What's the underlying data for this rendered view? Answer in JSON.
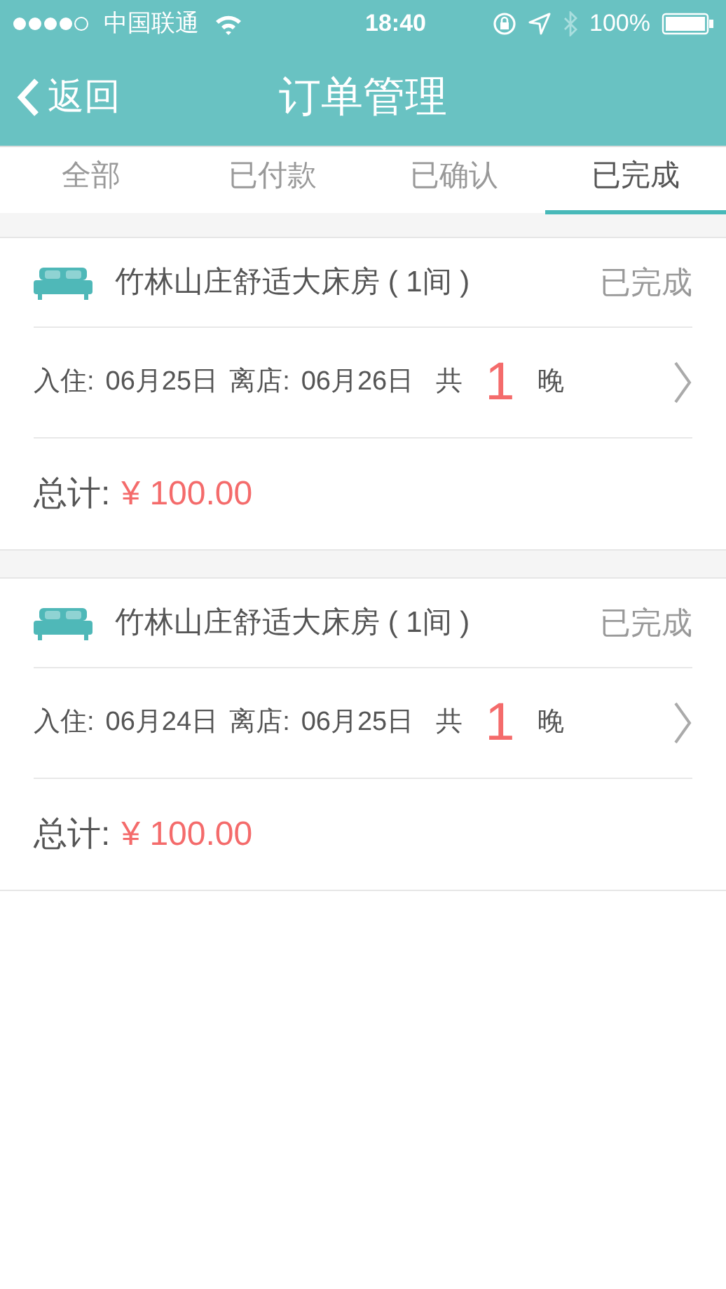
{
  "status_bar": {
    "carrier": "中国联通",
    "time": "18:40",
    "battery": "100%"
  },
  "nav": {
    "back": "返回",
    "title": "订单管理"
  },
  "tabs": [
    {
      "label": "全部",
      "selected": false
    },
    {
      "label": "已付款",
      "selected": false
    },
    {
      "label": "已确认",
      "selected": false
    },
    {
      "label": "已完成",
      "selected": true
    }
  ],
  "orders": [
    {
      "title": "竹林山庄舒适大床房 ( 1间 )",
      "status": "已完成",
      "checkin_label": "入住:",
      "checkin": "06月25日",
      "checkout_label": "离店:",
      "checkout": "06月26日",
      "nights_prefix": "共",
      "nights": "1",
      "nights_suffix": "晚",
      "total_label": "总计:",
      "total": "¥ 100.00"
    },
    {
      "title": "竹林山庄舒适大床房 ( 1间 )",
      "status": "已完成",
      "checkin_label": "入住:",
      "checkin": "06月24日",
      "checkout_label": "离店:",
      "checkout": "06月25日",
      "nights_prefix": "共",
      "nights": "1",
      "nights_suffix": "晚",
      "total_label": "总计:",
      "total": "¥ 100.00"
    }
  ]
}
